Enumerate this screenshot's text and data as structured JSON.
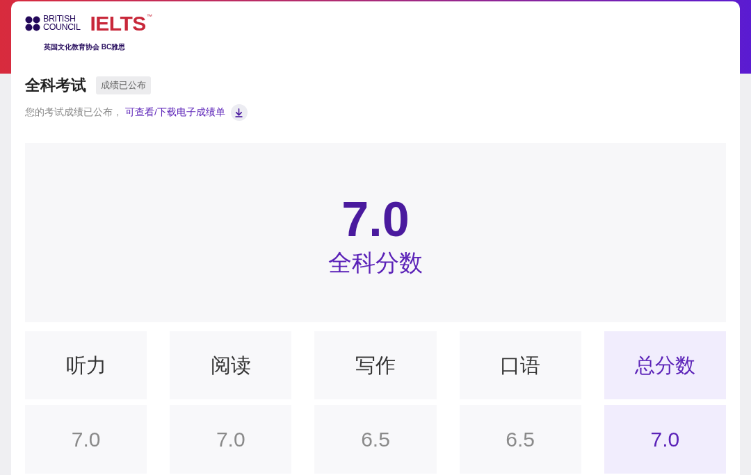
{
  "brand": {
    "logo_line_1": "BRITISH",
    "logo_line_2": "COUNCIL",
    "product": "IELTS",
    "trademark": "™",
    "subtitle": "英国文化教育协会 BC雅思"
  },
  "exam": {
    "title": "全科考试",
    "status_badge": "成绩已公布",
    "notice": "您的考试成绩已公布，",
    "download_link": "可查看/下载电子成绩单"
  },
  "overall": {
    "score": "7.0",
    "label": "全科分数"
  },
  "scores": [
    {
      "label": "听力",
      "score": "7.0",
      "highlighted": false
    },
    {
      "label": "阅读",
      "score": "7.0",
      "highlighted": false
    },
    {
      "label": "写作",
      "score": "6.5",
      "highlighted": false
    },
    {
      "label": "口语",
      "score": "6.5",
      "highlighted": false
    },
    {
      "label": "总分数",
      "score": "7.0",
      "highlighted": true
    }
  ]
}
